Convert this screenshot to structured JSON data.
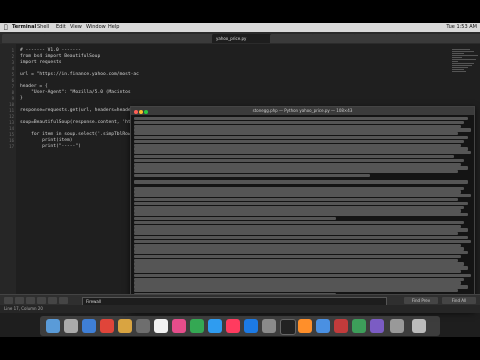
{
  "menubar": {
    "apple": "",
    "app": "Terminal",
    "items": [
      "Shell",
      "Edit",
      "View",
      "Window",
      "Help"
    ],
    "clock": "Tue 1:53 AM"
  },
  "editor": {
    "active_tab": "yahoo_price.py",
    "lines": [
      "# ------- V1.0 -------",
      "from bs4 import BeautifulSoup",
      "import requests",
      "",
      "url = \"https://in.finance.yahoo.com/most-ac",
      "",
      "header = {",
      "    \"User-Agent\": \"Mozilla/5.0 (Macintos",
      "}",
      "",
      "response=requests.get(url, headers=heade",
      "",
      "soup=BeautifulSoup(response.content, 'ht",
      "",
      "    for item in soup.select('.simpTblRow')",
      "        print(item)",
      "        print(\"-----\")"
    ]
  },
  "terminal": {
    "title": "stonegg.php — Python yahoo_price.py — 108×43"
  },
  "findbar": {
    "value": "Firewall",
    "find_prev": "Find Prev",
    "find_all": "Find All"
  },
  "status": {
    "position": "Line 17, Column 20"
  }
}
